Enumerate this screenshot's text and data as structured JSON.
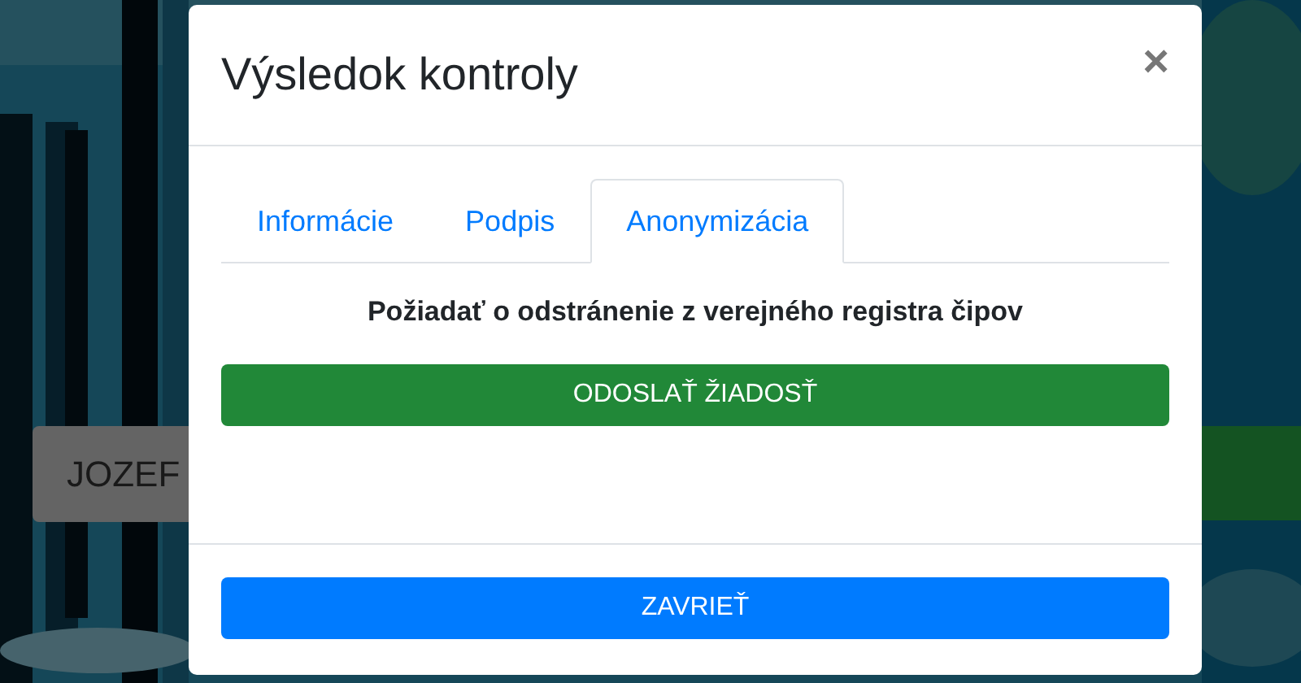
{
  "name_button": {
    "label": "JOZEF"
  },
  "modal": {
    "title": "Výsledok kontroly",
    "close_icon": "×",
    "tabs": [
      {
        "label": "Informácie",
        "selected": false
      },
      {
        "label": "Podpis",
        "selected": false
      },
      {
        "label": "Anonymizácia",
        "selected": true
      }
    ],
    "heading": "Požiadať o odstránenie z verejného registra čipov",
    "submit_button": "ODOSLAŤ ŽIADOSŤ",
    "close_button": "ZAVRIEŤ"
  }
}
